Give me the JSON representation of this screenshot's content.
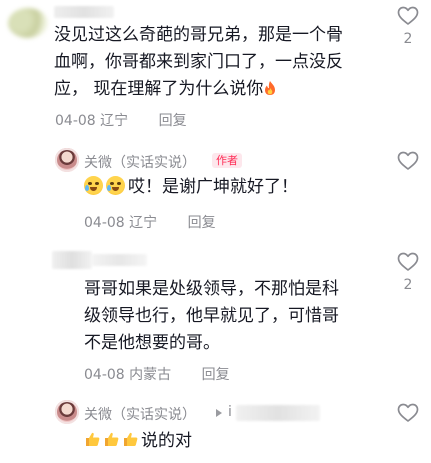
{
  "comments": [
    {
      "text_lines": [
        "没见过这么奇葩的哥兄弟，那是一个骨",
        "血啊，你哥都来到家门口了，一点没反",
        "应， 现在理解了为什么说你"
      ],
      "date": "04-08",
      "location": "辽宁",
      "reply_label": "回复",
      "like_count": "2"
    },
    {
      "text_lines": [
        "哥哥如果是处级领导，不那怕是科",
        "级领导也行，他早就见了，可惜哥",
        "不是他想要的哥。"
      ],
      "date": "04-08",
      "location": "内蒙古",
      "reply_label": "回复",
      "like_count": "2"
    }
  ],
  "replies": [
    {
      "author": "关微（实话实说）",
      "author_tag": "作者",
      "text": "哎！是谢广坤就好了！",
      "date": "04-08",
      "location": "辽宁",
      "reply_label": "回复"
    },
    {
      "author": "关微（实话实说）",
      "reply_to_partial": "i",
      "text": "说的对"
    }
  ],
  "icons": {
    "like": "heart-outline-icon",
    "fire": "fire-emoji-icon",
    "cry_laugh": "crying-laughing-emoji-icon",
    "thumbs_up": "thumbs-up-emoji-icon",
    "reply_arrow": "play-arrow-icon"
  },
  "colors": {
    "text": "#161823",
    "meta": "#8a8b91",
    "author_tag_bg": "#fde7ec",
    "author_tag_text": "#fe2c55"
  }
}
